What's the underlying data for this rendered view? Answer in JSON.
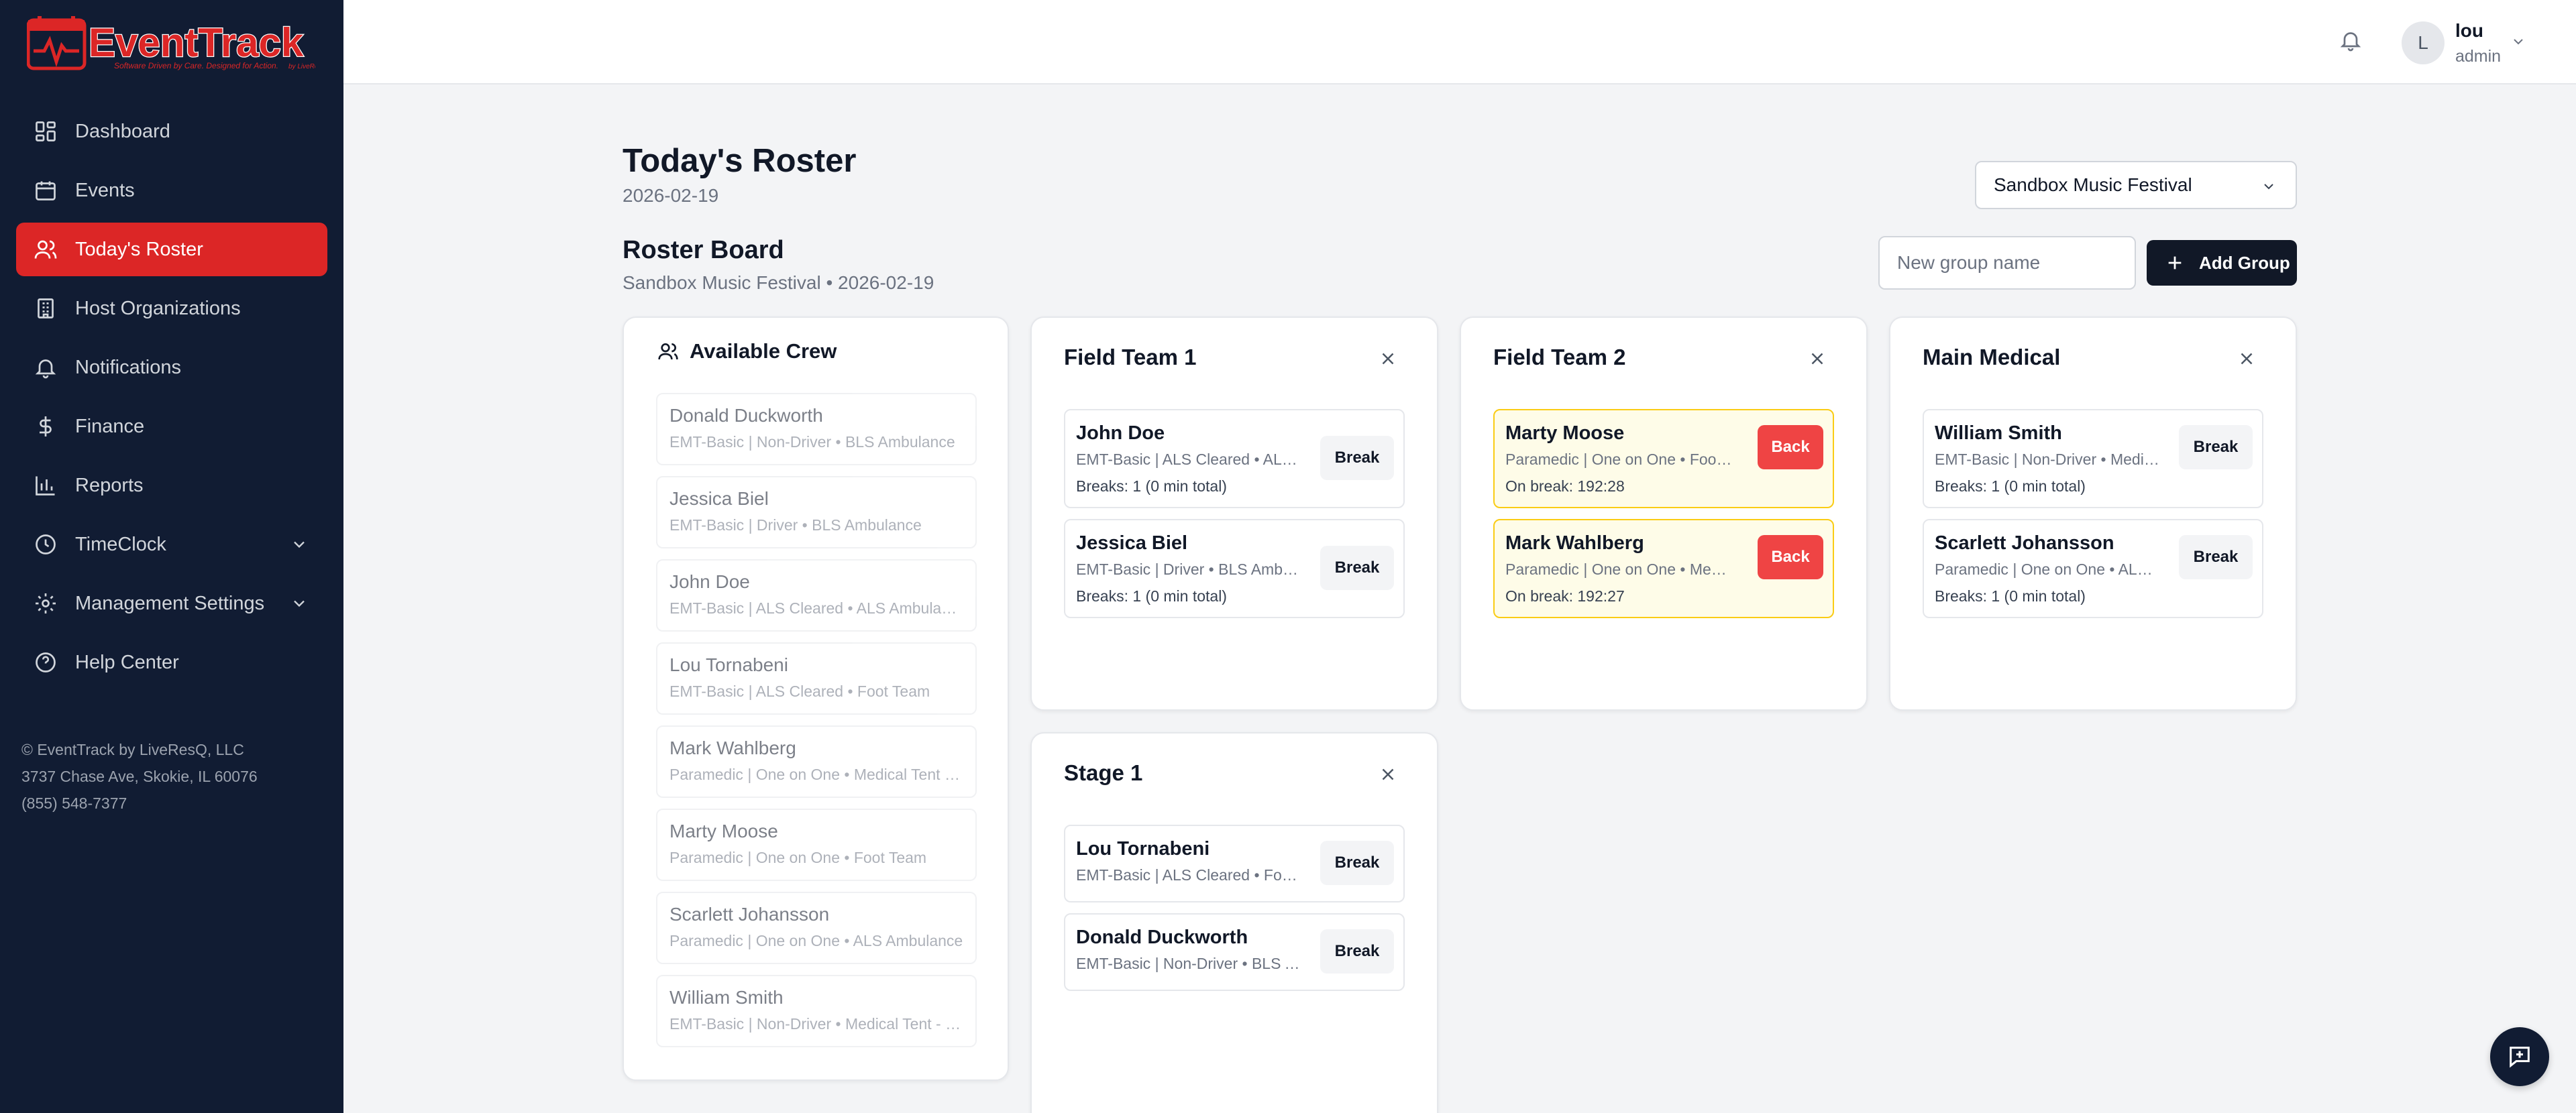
{
  "brand": {
    "name": "EventTrack",
    "tagline": "Software Driven by Care. Designed for Action.",
    "byline": "by LiveResQ",
    "color": "#dc2626"
  },
  "sidebar": {
    "items": [
      {
        "label": "Dashboard",
        "icon": "grid-icon"
      },
      {
        "label": "Events",
        "icon": "calendar-icon"
      },
      {
        "label": "Today's Roster",
        "icon": "users-icon",
        "active": true
      },
      {
        "label": "Host Organizations",
        "icon": "building-icon"
      },
      {
        "label": "Notifications",
        "icon": "bell-icon"
      },
      {
        "label": "Finance",
        "icon": "dollar-icon"
      },
      {
        "label": "Reports",
        "icon": "bar-chart-icon"
      },
      {
        "label": "TimeClock",
        "icon": "clock-icon",
        "expandable": true
      },
      {
        "label": "Management Settings",
        "icon": "gear-icon",
        "expandable": true
      },
      {
        "label": "Help Center",
        "icon": "help-circle-icon"
      }
    ],
    "footer": {
      "copyright": "© EventTrack by LiveResQ, LLC",
      "address": "3737 Chase Ave, Skokie, IL 60076",
      "phone": "(855) 548-7377"
    }
  },
  "topbar": {
    "user_initial": "L",
    "user_name": "lou",
    "user_role": "admin"
  },
  "header": {
    "title": "Today's Roster",
    "date": "2026-02-19",
    "event_select": "Sandbox Music Festival"
  },
  "board": {
    "title": "Roster Board",
    "subtitle": "Sandbox Music Festival • 2026-02-19",
    "group_input_placeholder": "New group name",
    "add_group_label": "Add Group"
  },
  "available_crew": {
    "title": "Available Crew",
    "items": [
      {
        "name": "Donald Duckworth",
        "meta": "EMT-Basic | Non-Driver • BLS Ambulance"
      },
      {
        "name": "Jessica Biel",
        "meta": "EMT-Basic | Driver • BLS Ambulance"
      },
      {
        "name": "John Doe",
        "meta": "EMT-Basic | ALS Cleared • ALS Ambulance"
      },
      {
        "name": "Lou Tornabeni",
        "meta": "EMT-Basic | ALS Cleared • Foot Team"
      },
      {
        "name": "Mark Wahlberg",
        "meta": "Paramedic | One on One • Medical Tent - Main"
      },
      {
        "name": "Marty Moose",
        "meta": "Paramedic | One on One • Foot Team"
      },
      {
        "name": "Scarlett Johansson",
        "meta": "Paramedic | One on One • ALS Ambulance"
      },
      {
        "name": "William Smith",
        "meta": "EMT-Basic | Non-Driver • Medical Tent - Main"
      }
    ]
  },
  "groups": [
    {
      "title": "Field Team 1",
      "members": [
        {
          "name": "John Doe",
          "meta": "EMT-Basic | ALS Cleared • ALS Ambulance",
          "status": "Breaks: 1 (0 min total)",
          "button": "Break",
          "on_break": false
        },
        {
          "name": "Jessica Biel",
          "meta": "EMT-Basic | Driver • BLS Ambulance",
          "status": "Breaks: 1 (0 min total)",
          "button": "Break",
          "on_break": false
        }
      ]
    },
    {
      "title": "Field Team 2",
      "members": [
        {
          "name": "Marty Moose",
          "meta": "Paramedic | One on One • Foot Team",
          "status": "On break: 192:28",
          "button": "Back",
          "on_break": true
        },
        {
          "name": "Mark Wahlberg",
          "meta": "Paramedic | One on One • Medical Tent - Main",
          "status": "On break: 192:27",
          "button": "Back",
          "on_break": true
        }
      ]
    },
    {
      "title": "Main Medical",
      "members": [
        {
          "name": "William Smith",
          "meta": "EMT-Basic | Non-Driver • Medical Tent - Main",
          "status": "Breaks: 1 (0 min total)",
          "button": "Break",
          "on_break": false
        },
        {
          "name": "Scarlett Johansson",
          "meta": "Paramedic | One on One • ALS Ambulance",
          "status": "Breaks: 1 (0 min total)",
          "button": "Break",
          "on_break": false
        }
      ]
    },
    {
      "title": "Stage 1",
      "members": [
        {
          "name": "Lou Tornabeni",
          "meta": "EMT-Basic | ALS Cleared • Foot Team",
          "button": "Break",
          "on_break": false
        },
        {
          "name": "Donald Duckworth",
          "meta": "EMT-Basic | Non-Driver • BLS Ambulance",
          "button": "Break",
          "on_break": false
        }
      ]
    }
  ]
}
